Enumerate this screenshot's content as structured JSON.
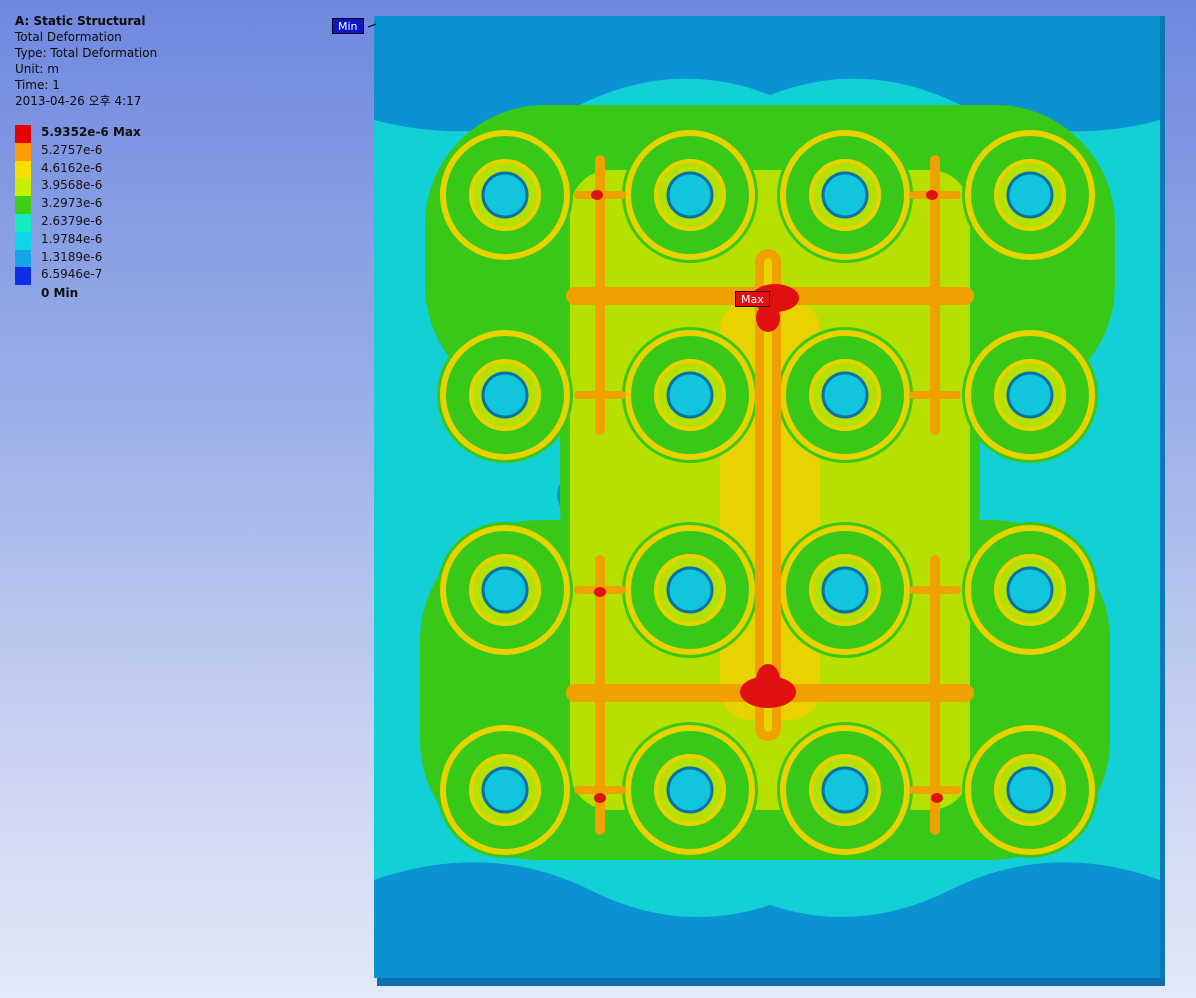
{
  "result": {
    "title": "A: Static Structural",
    "subtitle": "Total Deformation",
    "type": "Type: Total Deformation",
    "unit": "Unit: m",
    "time": "Time: 1",
    "date": "2013-04-26 오후 4:17"
  },
  "legend": {
    "levels": [
      {
        "label": "5.9352e-6 Max",
        "color": "#e60000",
        "bold": true
      },
      {
        "label": "5.2757e-6",
        "color": "#ff9a00"
      },
      {
        "label": "4.6162e-6",
        "color": "#f7dd00"
      },
      {
        "label": "3.9568e-6",
        "color": "#c6f000"
      },
      {
        "label": "3.2973e-6",
        "color": "#3ccf14"
      },
      {
        "label": "2.6379e-6",
        "color": "#12ecc0"
      },
      {
        "label": "1.9784e-6",
        "color": "#0ed6e6"
      },
      {
        "label": "1.3189e-6",
        "color": "#14a6e8"
      },
      {
        "label": "6.5946e-7",
        "color": "#0d2ee6"
      }
    ],
    "min_label": "0 Min"
  },
  "probes": {
    "min": "Min",
    "max": "Max"
  },
  "colors": {
    "plate": "#13cfd6",
    "plate_low": "#0a92d2",
    "plate_edge": "#0a6fa8",
    "green": "#38c818",
    "yellow_green": "#b6e000",
    "yellow": "#e8d200",
    "orange": "#f0a000",
    "red": "#e01010",
    "hub": "#11c6dc",
    "hub_dark": "#0a70a8"
  }
}
